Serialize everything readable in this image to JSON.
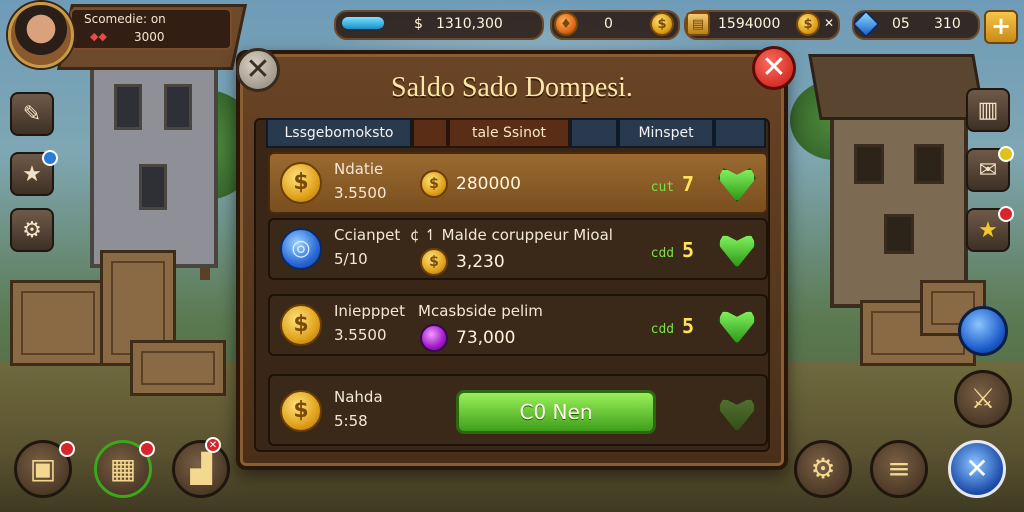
{
  "player": {
    "name": "Scomedie:  on",
    "gem_icon": "ruby-icon",
    "value": "3000"
  },
  "resources": {
    "energy": "1310,300",
    "fire": "0",
    "gold": "1594000",
    "gems_left": "05",
    "gems_right": "310"
  },
  "modal": {
    "title": "Saldo Sado Dompesi.",
    "tabs": [
      "Lssgebomoksto",
      "",
      "tale Ssinot",
      "",
      "Minspet",
      ""
    ],
    "rows": [
      {
        "name": "Ndatie",
        "price": "3.5500",
        "mid_label": "",
        "amount": "280000",
        "stat_label": "cut",
        "stat_value": "7",
        "coin": "$"
      },
      {
        "name": "Ccianpet",
        "price": "5/10",
        "mid_label": "Malde coruppeur Mioal",
        "amount": "3,230",
        "stat_label": "cdd",
        "stat_value": "5",
        "coin": ""
      },
      {
        "name": "Iniepppet",
        "price": "3.5500",
        "mid_label": "Mcasbside pelim",
        "amount": "73,000",
        "stat_label": "cdd",
        "stat_value": "5",
        "coin": "$"
      },
      {
        "name": "Nahda",
        "price": "5:58",
        "button": "C0 Nen",
        "coin": "$"
      }
    ]
  },
  "colors": {
    "accent": "#f9e6a8",
    "green": "#7be04a",
    "panel": "#4a2e18"
  }
}
